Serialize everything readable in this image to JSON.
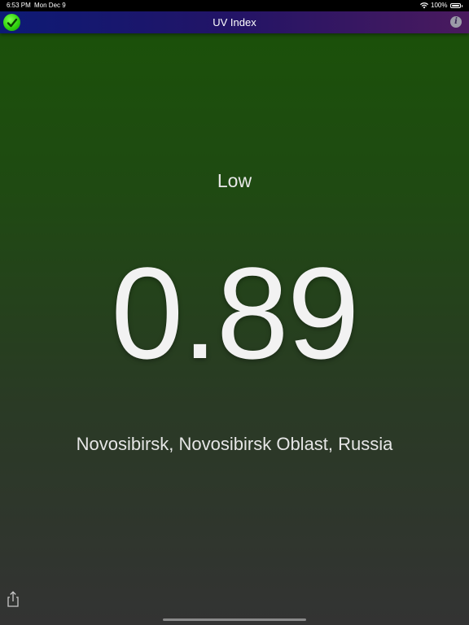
{
  "status_bar": {
    "time": "6:53 PM",
    "date": "Mon Dec 9",
    "battery": "100%",
    "battery_level": 1.0
  },
  "nav": {
    "title": "UV Index",
    "check_icon": "checkmark-icon",
    "info_label": "i"
  },
  "uv": {
    "level": "Low",
    "value": "0.89",
    "location": "Novosibirsk, Novosibirsk Oblast, Russia"
  },
  "toolbar": {
    "share_icon": "share-icon"
  },
  "colors": {
    "background_top": "#1a5208",
    "background_bottom": "#333333",
    "nav_left": "#0d1a75",
    "nav_right": "#4a1a5e",
    "check_green": "#2fd30f"
  }
}
